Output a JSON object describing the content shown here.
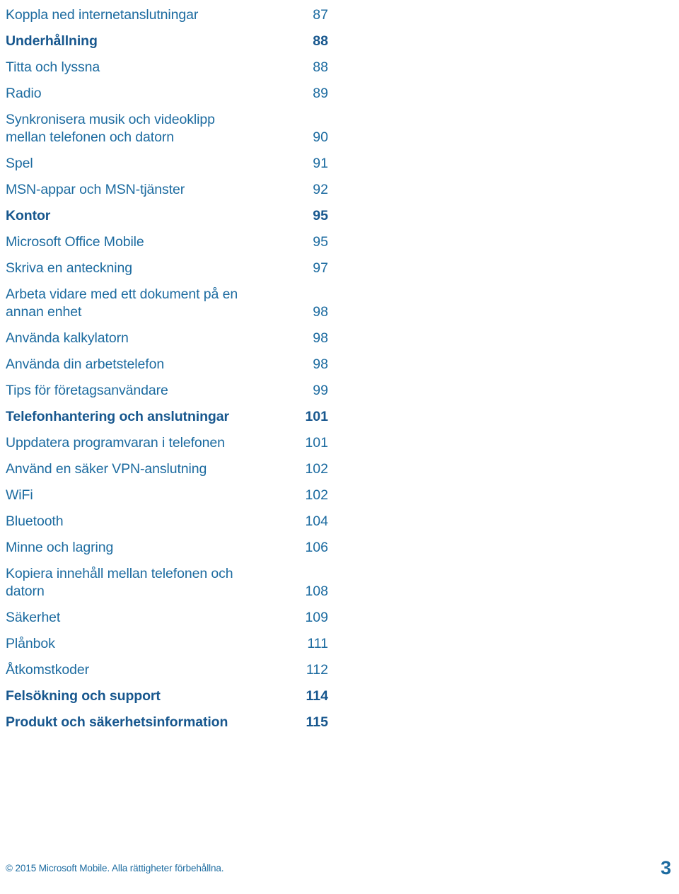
{
  "document": {
    "type": "table-of-contents",
    "language": "sv",
    "colors": {
      "body_text": "#1c6ba0",
      "heading_text": "#17578e",
      "background": "#ffffff"
    }
  },
  "toc": {
    "entries": [
      {
        "title": "Koppla ned internetanslutningar",
        "page": "87",
        "heading": false,
        "lines": 1
      },
      {
        "title": "Underhållning",
        "page": "88",
        "heading": true,
        "lines": 1
      },
      {
        "title": "Titta och lyssna",
        "page": "88",
        "heading": false,
        "lines": 1
      },
      {
        "title": "Radio",
        "page": "89",
        "heading": false,
        "lines": 1
      },
      {
        "title": "Synkronisera musik och videoklipp\nmellan telefonen och datorn",
        "page": "90",
        "heading": false,
        "lines": 2
      },
      {
        "title": "Spel",
        "page": "91",
        "heading": false,
        "lines": 1
      },
      {
        "title": "MSN-appar och MSN-tjänster",
        "page": "92",
        "heading": false,
        "lines": 1
      },
      {
        "title": "Kontor",
        "page": "95",
        "heading": true,
        "lines": 1
      },
      {
        "title": "Microsoft Office Mobile",
        "page": "95",
        "heading": false,
        "lines": 1
      },
      {
        "title": "Skriva en anteckning",
        "page": "97",
        "heading": false,
        "lines": 1
      },
      {
        "title": "Arbeta vidare med ett dokument på en\nannan enhet",
        "page": "98",
        "heading": false,
        "lines": 2
      },
      {
        "title": "Använda kalkylatorn",
        "page": "98",
        "heading": false,
        "lines": 1
      },
      {
        "title": "Använda din arbetstelefon",
        "page": "98",
        "heading": false,
        "lines": 1
      },
      {
        "title": "Tips för företagsanvändare",
        "page": "99",
        "heading": false,
        "lines": 1
      },
      {
        "title": "Telefonhantering och anslutningar",
        "page": "101",
        "heading": true,
        "lines": 1
      },
      {
        "title": "Uppdatera programvaran i telefonen",
        "page": "101",
        "heading": false,
        "lines": 1
      },
      {
        "title": "Använd en säker VPN-anslutning",
        "page": "102",
        "heading": false,
        "lines": 1
      },
      {
        "title": "WiFi",
        "page": "102",
        "heading": false,
        "lines": 1
      },
      {
        "title": "Bluetooth",
        "page": "104",
        "heading": false,
        "lines": 1
      },
      {
        "title": "Minne och lagring",
        "page": "106",
        "heading": false,
        "lines": 1
      },
      {
        "title": "Kopiera innehåll mellan telefonen och\ndatorn",
        "page": "108",
        "heading": false,
        "lines": 2
      },
      {
        "title": "Säkerhet",
        "page": "109",
        "heading": false,
        "lines": 1
      },
      {
        "title": "Plånbok",
        "page": "111",
        "heading": false,
        "lines": 1
      },
      {
        "title": "Åtkomstkoder",
        "page": "112",
        "heading": false,
        "lines": 1
      },
      {
        "title": "Felsökning och support",
        "page": "114",
        "heading": true,
        "lines": 1
      },
      {
        "title": "Produkt och säkerhetsinformation",
        "page": "115",
        "heading": true,
        "lines": 1
      }
    ]
  },
  "footer": {
    "copyright": "© 2015 Microsoft Mobile. Alla rättigheter förbehållna.",
    "page_number": "3"
  }
}
